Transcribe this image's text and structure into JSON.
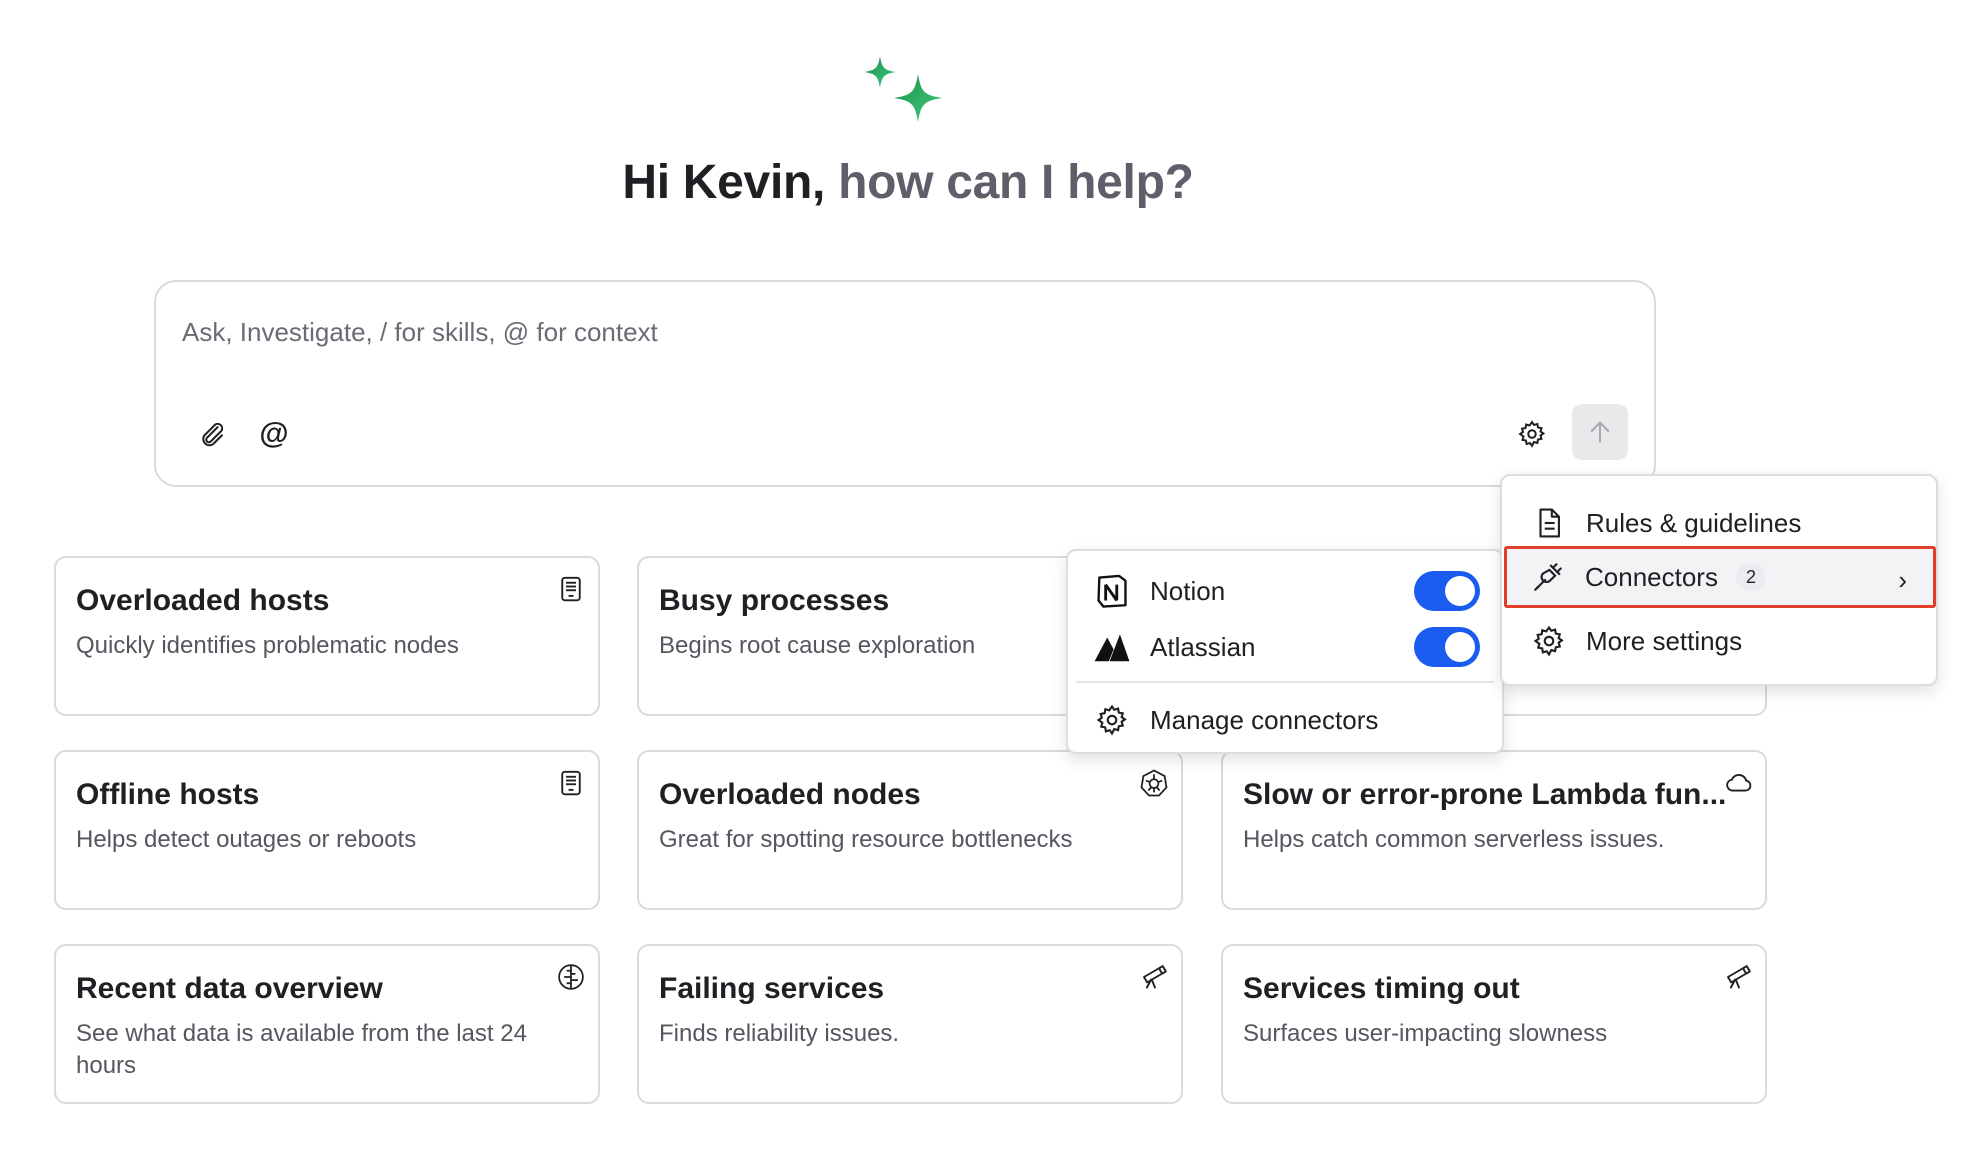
{
  "greeting": {
    "hi": "Hi Kevin,",
    "help": "how can I help?"
  },
  "prompt": {
    "placeholder": "Ask, Investigate, / for skills, @ for context",
    "mention_symbol": "@"
  },
  "cards": [
    {
      "title": "Overloaded hosts",
      "desc": "Quickly identifies problematic nodes",
      "icon": "server-icon"
    },
    {
      "title": "Busy processes",
      "desc": "Begins root cause exploration",
      "icon": ""
    },
    {
      "title": "Offline hosts",
      "desc": "Helps detect outages or reboots",
      "icon": "server-icon"
    },
    {
      "title": "Overloaded nodes",
      "desc": "Great for spotting resource bottlenecks",
      "icon": "kubernetes-icon"
    },
    {
      "title": "Slow or error-prone Lambda fun...",
      "desc": "Helps catch common serverless issues.",
      "icon": "cloud-icon"
    },
    {
      "title": "Recent data overview",
      "desc": "See what data is available from the last 24 hours",
      "icon": "brain-icon"
    },
    {
      "title": "Failing services",
      "desc": "Finds reliability issues.",
      "icon": "telescope-icon"
    },
    {
      "title": "Services timing out",
      "desc": "Surfaces user-impacting slowness",
      "icon": "telescope-icon"
    }
  ],
  "connectors_panel": {
    "items": [
      {
        "label": "Notion",
        "enabled": true,
        "icon": "notion-icon"
      },
      {
        "label": "Atlassian",
        "enabled": true,
        "icon": "atlassian-icon"
      }
    ],
    "manage_label": "Manage connectors"
  },
  "settings_menu": {
    "rules_label": "Rules & guidelines",
    "connectors_label": "Connectors",
    "connectors_count": "2",
    "more_label": "More settings"
  },
  "colors": {
    "accent": "#1b5cf0",
    "highlight_border": "#e0402b",
    "sparkle_green": "#2fb866"
  }
}
